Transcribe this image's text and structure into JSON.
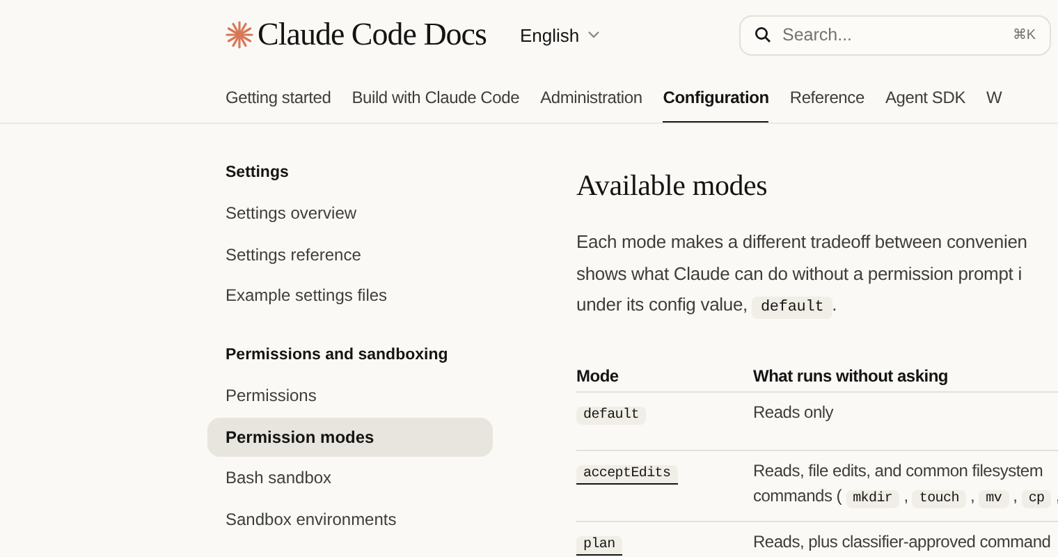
{
  "header": {
    "logo_text": "Claude Code Docs",
    "language": "English",
    "search": {
      "placeholder": "Search...",
      "shortcut": "⌘K"
    }
  },
  "nav_tabs": [
    {
      "label": "Getting started",
      "selected": false
    },
    {
      "label": "Build with Claude Code",
      "selected": false
    },
    {
      "label": "Administration",
      "selected": false
    },
    {
      "label": "Configuration",
      "selected": true
    },
    {
      "label": "Reference",
      "selected": false
    },
    {
      "label": "Agent SDK",
      "selected": false
    },
    {
      "label": "W",
      "selected": false
    }
  ],
  "sidebar": {
    "sections": [
      {
        "heading": "Settings",
        "items": [
          {
            "label": "Settings overview",
            "selected": false
          },
          {
            "label": "Settings reference",
            "selected": false
          },
          {
            "label": "Example settings files",
            "selected": false
          }
        ]
      },
      {
        "heading": "Permissions and sandboxing",
        "items": [
          {
            "label": "Permissions",
            "selected": false
          },
          {
            "label": "Permission modes",
            "selected": true
          },
          {
            "label": "Bash sandbox",
            "selected": false
          },
          {
            "label": "Sandbox environments",
            "selected": false
          }
        ]
      }
    ]
  },
  "content": {
    "heading": "Available modes",
    "paragraph_lines": [
      [
        {
          "kind": "text",
          "text": "Each mode makes a different tradeoff between convenien"
        }
      ],
      [
        {
          "kind": "text",
          "text": "shows what Claude can do without a permission prompt i"
        }
      ],
      [
        {
          "kind": "text",
          "text": "under its config value, "
        },
        {
          "kind": "code",
          "text": "default"
        },
        {
          "kind": "text",
          "text": "."
        }
      ]
    ],
    "table": {
      "columns": [
        "Mode",
        "What runs without asking"
      ],
      "rows": [
        {
          "mode": {
            "text": "default",
            "linked": false
          },
          "lines": [
            [
              {
                "kind": "text",
                "text": "Reads only"
              }
            ]
          ]
        },
        {
          "mode": {
            "text": "acceptEdits",
            "linked": true
          },
          "lines": [
            [
              {
                "kind": "text",
                "text": "Reads, file edits, and common filesystem"
              }
            ],
            [
              {
                "kind": "text",
                "text": "commands ( "
              },
              {
                "kind": "code",
                "text": "mkdir"
              },
              {
                "kind": "text",
                "text": " , "
              },
              {
                "kind": "code",
                "text": "touch"
              },
              {
                "kind": "text",
                "text": " , "
              },
              {
                "kind": "code",
                "text": "mv"
              },
              {
                "kind": "text",
                "text": " , "
              },
              {
                "kind": "code",
                "text": "cp"
              },
              {
                "kind": "text",
                "text": " ,"
              }
            ]
          ]
        },
        {
          "mode": {
            "text": "plan",
            "linked": true
          },
          "lines": [
            [
              {
                "kind": "text",
                "text": "Reads, plus classifier-approved command"
              }
            ]
          ]
        }
      ]
    }
  }
}
